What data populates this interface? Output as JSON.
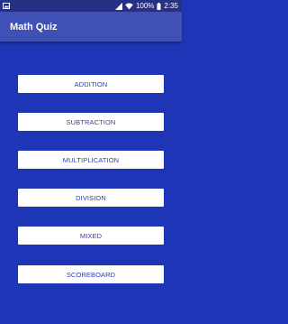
{
  "status_bar": {
    "battery_percent": "100%",
    "time": "2:35"
  },
  "app_bar": {
    "title": "Math Quiz"
  },
  "menu": {
    "buttons": [
      {
        "label": "ADDITION"
      },
      {
        "label": "SUBTRACTION"
      },
      {
        "label": "MULTIPLICATION"
      },
      {
        "label": "DIVISION"
      },
      {
        "label": "MIXED"
      },
      {
        "label": "SCOREBOARD"
      }
    ]
  },
  "colors": {
    "background": "#1f35b8",
    "app_bar": "#3f51b5",
    "status_bar": "#263186",
    "button_bg": "#ffffff",
    "button_text": "#2f3fa8"
  },
  "icons": {
    "status_left": "image-icon",
    "status_right": [
      "signal-icon",
      "wifi-icon",
      "battery-icon"
    ]
  }
}
